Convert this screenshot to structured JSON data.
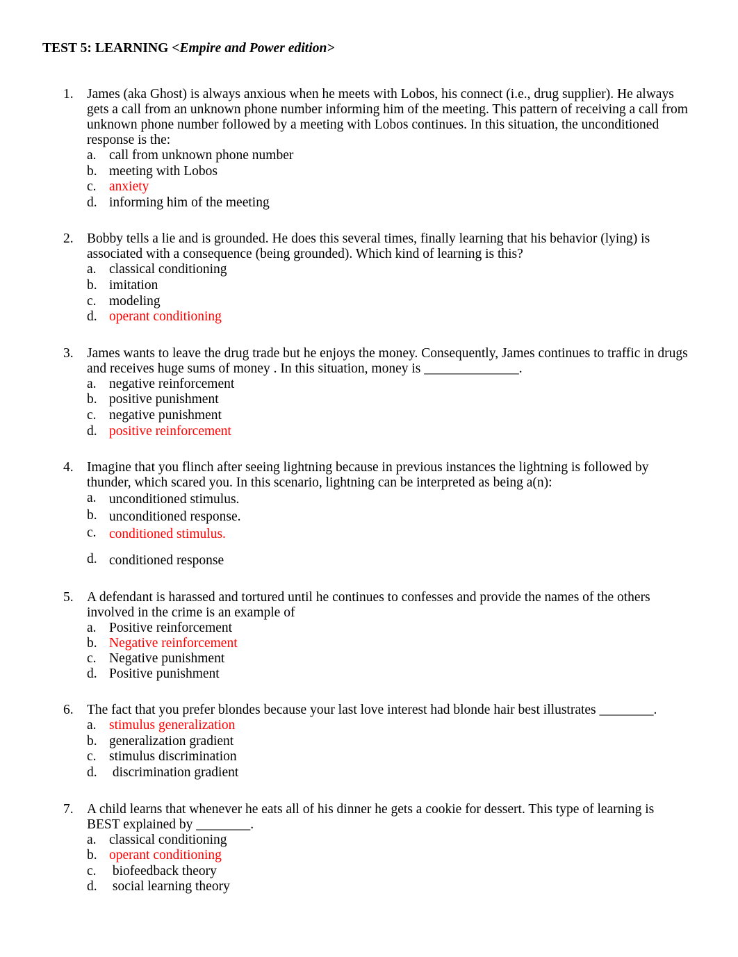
{
  "document": {
    "title_main": "TEST 5: LEARNING ",
    "title_edition": "<Empire and Power edition>",
    "answer_color": "#FF0000",
    "page_background": "#FFFFFF",
    "text_color": "#000000"
  },
  "questions": [
    {
      "number": "1.",
      "text": "James (aka Ghost) is always anxious when he meets with Lobos, his connect (i.e., drug supplier). He always gets a call from an unknown phone number informing him of the meeting. This pattern of receiving a call from unknown phone number followed by a meeting with Lobos continues. In this situation, the unconditioned response is the:",
      "options": [
        {
          "letter": "a.",
          "text": "call from unknown phone number",
          "is_answer": false
        },
        {
          "letter": "b.",
          "text": "meeting with Lobos",
          "is_answer": false
        },
        {
          "letter": "c.",
          "text": "anxiety",
          "is_answer": true
        },
        {
          "letter": "d.",
          "text": "informing him of the meeting",
          "is_answer": false
        }
      ]
    },
    {
      "number": "2.",
      "text": "Bobby tells a lie and is grounded. He does this several times, finally learning that his behavior (lying) is associated with a consequence (being grounded). Which kind of learning is this?",
      "options": [
        {
          "letter": "a.",
          "text": "classical conditioning",
          "is_answer": false
        },
        {
          "letter": "b.",
          "text": "imitation",
          "is_answer": false
        },
        {
          "letter": "c.",
          "text": "modeling",
          "is_answer": false
        },
        {
          "letter": "d.",
          "text": "operant conditioning",
          "is_answer": true
        }
      ]
    },
    {
      "number": "3.",
      "text": "James wants to leave the drug trade but he enjoys the money. Consequently, James continues to traffic in drugs and receives huge sums of money . In this situation, money is ______________.",
      "options": [
        {
          "letter": "a.",
          "text": "negative reinforcement",
          "is_answer": false
        },
        {
          "letter": "b.",
          "text": "positive punishment",
          "is_answer": false
        },
        {
          "letter": "c.",
          "text": "negative punishment",
          "is_answer": false
        },
        {
          "letter": "d.",
          "text": "positive reinforcement",
          "is_answer": true
        }
      ]
    },
    {
      "number": "4.",
      "text": "Imagine that you flinch after seeing lightning because in previous instances the lightning is followed by thunder, which scared you. In this scenario, lightning can be interpreted as being a(n):",
      "options": [
        {
          "letter": "a.",
          "text": "unconditioned stimulus.",
          "is_answer": false
        },
        {
          "letter": "b.",
          "text": "unconditioned response.",
          "is_answer": false
        },
        {
          "letter": "c.",
          "text": "conditioned stimulus.",
          "is_answer": true
        },
        {
          "letter": "d.",
          "text": "conditioned response",
          "is_answer": false
        }
      ]
    },
    {
      "number": "5.",
      "text": "A defendant is harassed and tortured until he continues to confesses and provide the names of the others involved in the crime is an example of",
      "options": [
        {
          "letter": "a.",
          "text": "Positive reinforcement",
          "is_answer": false
        },
        {
          "letter": "b.",
          "text": "Negative reinforcement",
          "is_answer": true
        },
        {
          "letter": "c.",
          "text": "Negative punishment",
          "is_answer": false
        },
        {
          "letter": "d.",
          "text": "Positive punishment",
          "is_answer": false
        }
      ]
    },
    {
      "number": "6.",
      "text": "The fact that you prefer blondes because your last love interest had blonde hair best illustrates ________.",
      "options": [
        {
          "letter": "a.",
          "text": "stimulus generalization",
          "is_answer": true
        },
        {
          "letter": "b.",
          "text": "generalization gradient",
          "is_answer": false
        },
        {
          "letter": "c.",
          "text": "stimulus discrimination",
          "is_answer": false
        },
        {
          "letter": "d.",
          "text": " discrimination gradient",
          "is_answer": false
        }
      ]
    },
    {
      "number": "7.",
      "text": "A child learns that whenever he eats all of his dinner he gets a cookie for dessert. This type of learning is BEST explained by ________.",
      "options": [
        {
          "letter": "a.",
          "text": "classical conditioning",
          "is_answer": false
        },
        {
          "letter": "b.",
          "text": "operant conditioning",
          "is_answer": true
        },
        {
          "letter": "c.",
          "text": " biofeedback theory",
          "is_answer": false
        },
        {
          "letter": "d.",
          "text": " social learning theory",
          "is_answer": false
        }
      ]
    }
  ]
}
